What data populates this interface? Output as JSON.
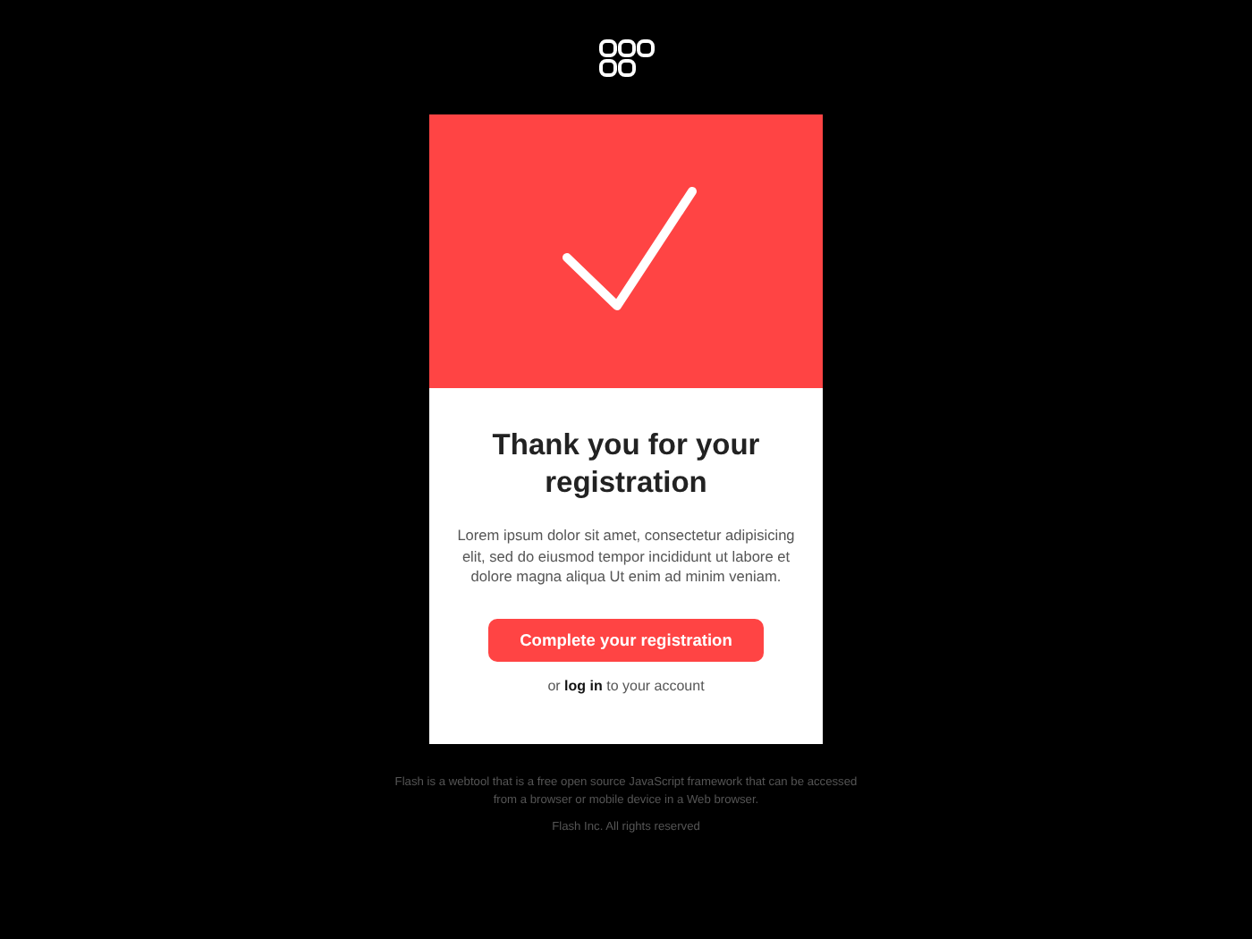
{
  "card": {
    "title": "Thank you for your registration",
    "body": "Lorem ipsum dolor sit amet, consectetur adipisicing elit, sed do eiusmod tempor incididunt ut labore et dolore magna aliqua Ut enim ad minim veniam.",
    "button": "Complete your registration",
    "login": {
      "before": "or ",
      "link": "log in",
      "after": " to your account"
    }
  },
  "footer": {
    "about": "Flash is a webtool that is a free open source JavaScript framework that can be accessed from a browser or mobile device in a Web browser.",
    "copyright": "Flash Inc. All rights reserved"
  }
}
